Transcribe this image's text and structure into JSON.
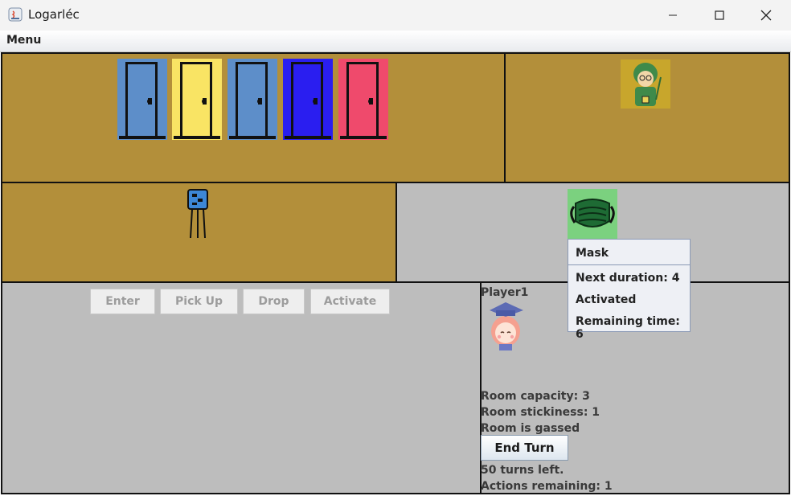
{
  "window": {
    "title": "Logarléc"
  },
  "menubar": {
    "menu_label": "Menu"
  },
  "doors": [
    {
      "color": "#5d8ec9"
    },
    {
      "color": "#f9e464"
    },
    {
      "color": "#5d8ec9"
    },
    {
      "color": "#2a1ef0"
    },
    {
      "color": "#ef4a6c"
    }
  ],
  "actions": {
    "enter": "Enter",
    "pick_up": "Pick Up",
    "drop": "Drop",
    "activate": "Activate"
  },
  "player": {
    "name": "Player1",
    "room_capacity": "Room capacity: 3",
    "room_stickiness": "Room stickiness: 1",
    "room_status": "Room is gassed",
    "end_turn": "End Turn",
    "turns_left": "50 turns left.",
    "actions_remaining": "Actions remaining: 1"
  },
  "tooltip": {
    "title": "Mask",
    "next_duration": "Next duration: 4",
    "status": "Activated",
    "remaining_time": "Remaining time: 6"
  },
  "colors": {
    "room_brown": "#b38f3a",
    "room_gray": "#bdbdbd",
    "mask_green": "#7bd17f"
  }
}
